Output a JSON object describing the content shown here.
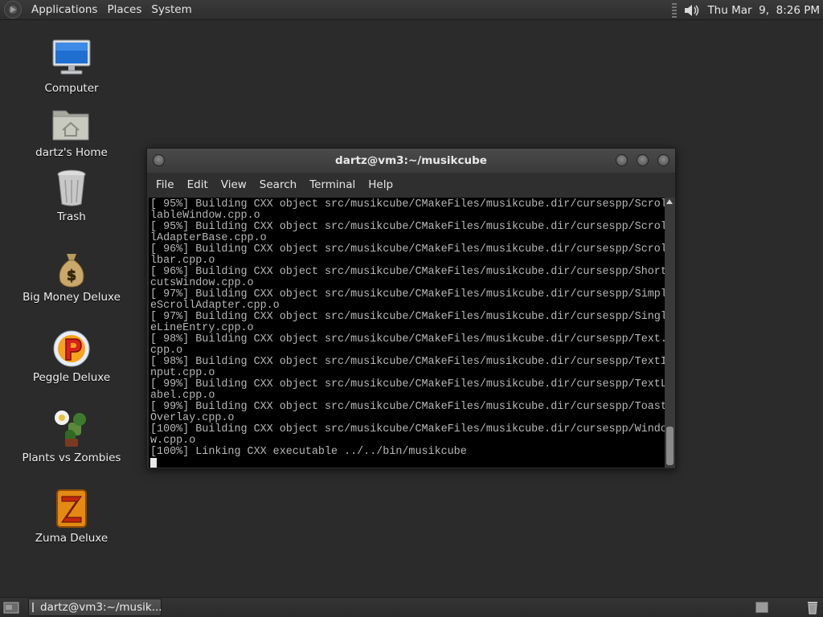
{
  "top_panel": {
    "menus": [
      "Applications",
      "Places",
      "System"
    ],
    "clock": "Thu Mar  9,  8:26 PM",
    "volume_icon": "volume-icon"
  },
  "desktop": {
    "icons": [
      {
        "label": "Computer",
        "icon": "computer-icon"
      },
      {
        "label": "dartz's Home",
        "icon": "home-folder-icon"
      },
      {
        "label": "Trash",
        "icon": "trash-icon"
      },
      {
        "label": "Big Money Deluxe",
        "icon": "money-bag-icon"
      },
      {
        "label": "Peggle Deluxe",
        "icon": "peggle-icon"
      },
      {
        "label": "Plants vs Zombies",
        "icon": "plants-icon"
      },
      {
        "label": "Zuma Deluxe",
        "icon": "zuma-icon"
      }
    ]
  },
  "terminal": {
    "title": "dartz@vm3:~/musikcube",
    "menu": [
      "File",
      "Edit",
      "View",
      "Search",
      "Terminal",
      "Help"
    ],
    "lines": [
      "[ 95%] Building CXX object src/musikcube/CMakeFiles/musikcube.dir/cursespp/Scrol",
      "lableWindow.cpp.o",
      "[ 95%] Building CXX object src/musikcube/CMakeFiles/musikcube.dir/cursespp/Scrol",
      "lAdapterBase.cpp.o",
      "[ 96%] Building CXX object src/musikcube/CMakeFiles/musikcube.dir/cursespp/Scrol",
      "lbar.cpp.o",
      "[ 96%] Building CXX object src/musikcube/CMakeFiles/musikcube.dir/cursespp/Short",
      "cutsWindow.cpp.o",
      "[ 97%] Building CXX object src/musikcube/CMakeFiles/musikcube.dir/cursespp/Simpl",
      "eScrollAdapter.cpp.o",
      "[ 97%] Building CXX object src/musikcube/CMakeFiles/musikcube.dir/cursespp/Singl",
      "eLineEntry.cpp.o",
      "[ 98%] Building CXX object src/musikcube/CMakeFiles/musikcube.dir/cursespp/Text.",
      "cpp.o",
      "[ 98%] Building CXX object src/musikcube/CMakeFiles/musikcube.dir/cursespp/TextI",
      "nput.cpp.o",
      "[ 99%] Building CXX object src/musikcube/CMakeFiles/musikcube.dir/cursespp/TextL",
      "abel.cpp.o",
      "[ 99%] Building CXX object src/musikcube/CMakeFiles/musikcube.dir/cursespp/Toast",
      "Overlay.cpp.o",
      "[100%] Building CXX object src/musikcube/CMakeFiles/musikcube.dir/cursespp/Windo",
      "w.cpp.o",
      "[100%] Linking CXX executable ../../bin/musikcube"
    ]
  },
  "taskbar": {
    "task_label": "dartz@vm3:~/musik..."
  }
}
